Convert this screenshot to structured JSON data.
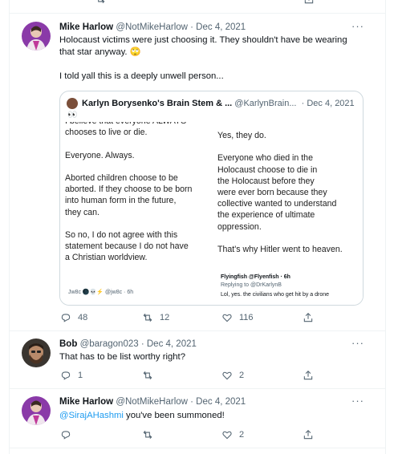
{
  "tweets": [
    {
      "name": "Mike Harlow",
      "handle": "@NotMikeHarlow",
      "date": "· Dec 4, 2021",
      "text_line1": "Holocaust victims were just choosing it. They shouldn't have be wearing",
      "text_line2": "that star anyway. 🙄",
      "text_line3": "I told yall this is a deeply unwell person...",
      "quote": {
        "name": "Karlyn Borysenko's Brain Stem & ...",
        "handle": "@KarlynBrain...",
        "date": "· Dec 4, 2021",
        "emoji": "👀",
        "left_col": [
          "I believe that everyone ALWAYS",
          "chooses to live or die.",
          "",
          "Everyone. Always.",
          "",
          "Aborted children choose to be",
          "aborted. If they choose to be born",
          "into human form in the future,",
          "they can.",
          "",
          "So no, I do not agree with this",
          "statement because I do not have",
          "a Christian worldview."
        ],
        "right_col": [
          "Yes, they do.",
          "",
          "Everyone who died in the",
          "Holocaust choose to die in",
          "the Holocaust before they",
          "were ever born because they",
          "collective wanted to understand",
          "the experience of ultimate",
          "oppression.",
          "",
          "That's why Hitler went to heaven."
        ],
        "mini_left_user": "Jw8c 🌑💀⚡ @jw8c · 6h",
        "mini_right_user": "Flyingfish @Flyenfish · 6h",
        "mini_right_reply": "Replying to @DrKarlynB",
        "mini_right_text": "Lol, yes. the civilians who get hit by a drone"
      },
      "replies": "48",
      "retweets": "12",
      "likes": "116"
    },
    {
      "name": "Bob",
      "handle": "@baragon023",
      "date": "· Dec 4, 2021",
      "text_line1": "That has to be list worthy right?",
      "replies": "1",
      "retweets": "",
      "likes": "2"
    },
    {
      "name": "Mike Harlow",
      "handle": "@NotMikeHarlow",
      "date": "· Dec 4, 2021",
      "mention": "@SirajAHashmi",
      "text_after_mention": " you've been summoned!",
      "replies": "",
      "retweets": "",
      "likes": "2"
    }
  ],
  "more_label": "···",
  "icons": [
    "reply-icon",
    "retweet-icon",
    "like-icon",
    "share-icon",
    "more-icon"
  ]
}
